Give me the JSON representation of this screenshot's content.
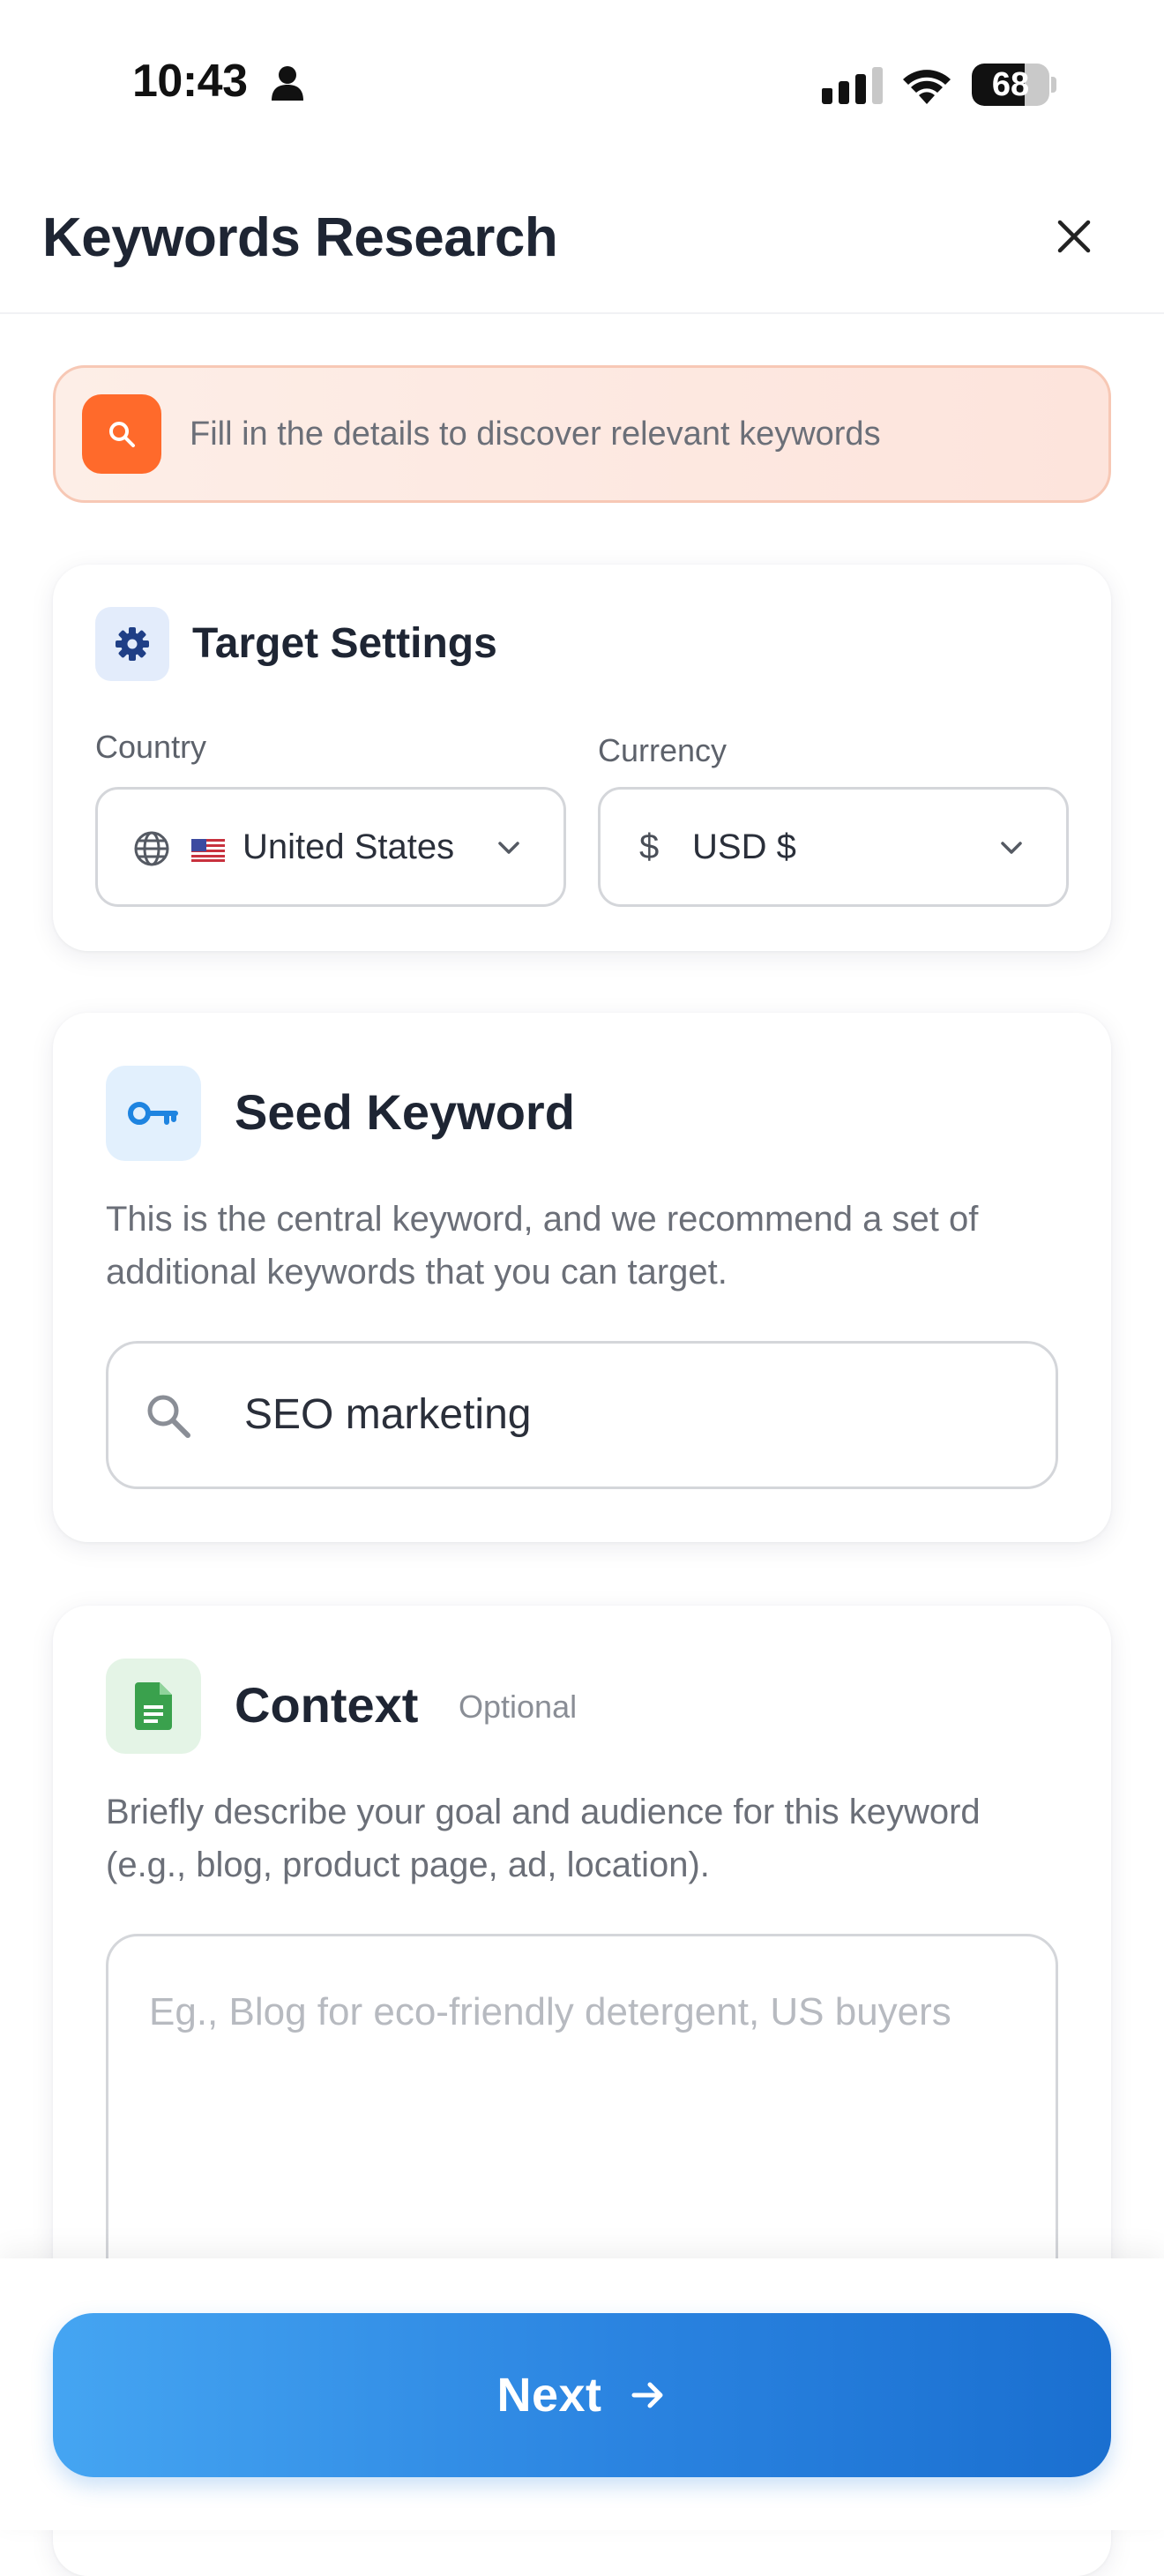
{
  "status_bar": {
    "time": "10:43",
    "battery": "68",
    "battery_level": 0.68,
    "icons": [
      "person-icon",
      "signal-icon",
      "wifi-icon",
      "battery-icon"
    ]
  },
  "header": {
    "title": "Keywords Research",
    "close_icon": "close-icon"
  },
  "banner": {
    "text": "Fill in the details to discover relevant keywords",
    "icon": "search-icon",
    "colors": {
      "icon_bg": "#ff6a2b",
      "bg": "#fde4dc",
      "border": "#f7c8b5"
    }
  },
  "target_settings": {
    "title": "Target Settings",
    "icon": "gear-icon",
    "country": {
      "label": "Country",
      "value": "United States",
      "flag": "us-flag-icon"
    },
    "currency": {
      "label": "Currency",
      "symbol": "$",
      "value": "USD $"
    }
  },
  "seed_keyword": {
    "title": "Seed Keyword",
    "icon": "key-icon",
    "description": "This is the central keyword, and we recommend a set of additional keywords that you can target.",
    "input_value": "SEO marketing"
  },
  "context": {
    "title": "Context",
    "badge": "Optional",
    "icon": "document-icon",
    "description": "Briefly describe your goal and audience for this keyword (e.g., blog, product page, ad, location).",
    "placeholder": "Eg., Blog for eco-friendly detergent, US buyers"
  },
  "footer": {
    "next_label": "Next",
    "arrow_icon": "arrow-right-icon",
    "accent": "#2a83e0"
  }
}
